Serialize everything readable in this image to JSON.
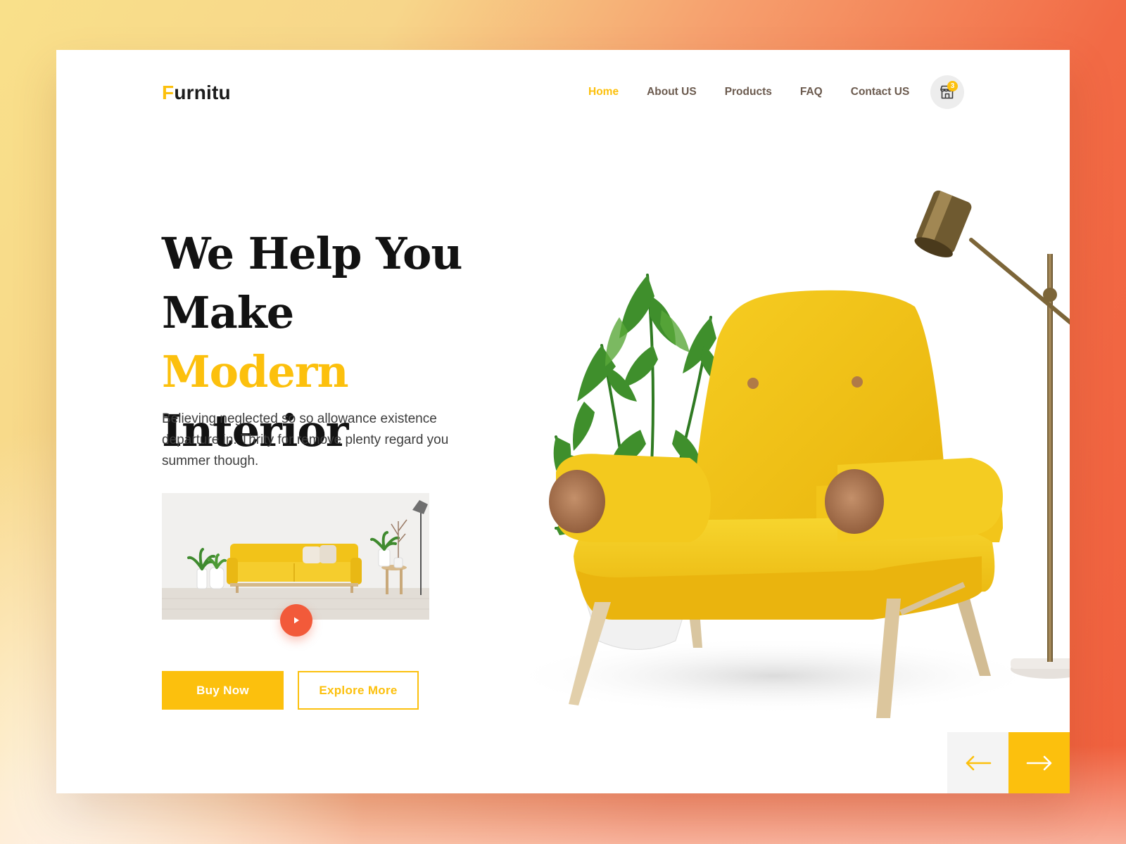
{
  "brand": {
    "first_letter": "F",
    "rest": "urnitu"
  },
  "nav": {
    "items": [
      {
        "label": "Home",
        "active": true
      },
      {
        "label": "About US",
        "active": false
      },
      {
        "label": "Products",
        "active": false
      },
      {
        "label": "FAQ",
        "active": false
      },
      {
        "label": "Contact US",
        "active": false
      }
    ]
  },
  "cart": {
    "count": "3",
    "icon": "store-cart-icon"
  },
  "hero": {
    "line1": "We Help You",
    "line2_start": "Make ",
    "line2_accent": "Modern",
    "line3": "Interior",
    "description": "Believing neglected so so allowance existence departure in. Thrity for remove plenty regard you summer though."
  },
  "video": {
    "play_icon": "play-icon"
  },
  "buttons": {
    "buy": "Buy Now",
    "explore": "Explore More"
  },
  "slider": {
    "prev_icon": "arrow-left-icon",
    "next_icon": "arrow-right-icon"
  },
  "colors": {
    "accent": "#fcc00d",
    "play": "#f25a3a",
    "text": "#121212"
  }
}
